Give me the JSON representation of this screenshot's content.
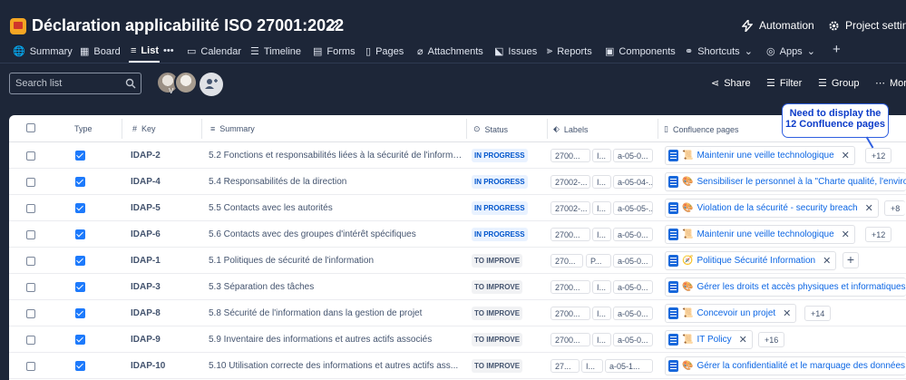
{
  "header": {
    "title": "Déclaration applicabilité ISO 27001:2022",
    "automation_label": "Automation",
    "settings_label": "Project setting"
  },
  "tabs": [
    {
      "label": "Summary"
    },
    {
      "label": "Board"
    },
    {
      "label": "List"
    },
    {
      "label": "•••"
    },
    {
      "label": "Calendar"
    },
    {
      "label": "Timeline"
    },
    {
      "label": "Forms"
    },
    {
      "label": "Pages"
    },
    {
      "label": "Attachments"
    },
    {
      "label": "Issues"
    },
    {
      "label": "Reports"
    },
    {
      "label": "Components"
    },
    {
      "label": "Shortcuts"
    },
    {
      "label": "Apps"
    },
    {
      "label": "+"
    }
  ],
  "toolbar": {
    "search_placeholder": "Search list",
    "avatar_badge": "V",
    "share_label": "Share",
    "filter_label": "Filter",
    "group_label": "Group",
    "more_label": "Mor"
  },
  "columns": {
    "type": "Type",
    "key": "Key",
    "summary": "Summary",
    "status": "Status",
    "labels": "Labels",
    "confluence": "Confluence pages"
  },
  "callout": "Need to display the 12 Confluence pages",
  "rows": [
    {
      "key": "IDAP-2",
      "summary": "5.2 Fonctions et responsabilités liées à la sécurité de l'informa...",
      "status": "IN PROGRESS",
      "status_type": "progress",
      "label1": "2700...",
      "label2": "I...",
      "label3": "a-05-0...",
      "page_emoji": "📜",
      "page": "Maintenir une veille technologique",
      "more": "+12"
    },
    {
      "key": "IDAP-4",
      "summary": "5.4 Responsabilités de la direction",
      "status": "IN PROGRESS",
      "status_type": "progress",
      "label1": "27002-...",
      "label2": "I...",
      "label3": "a-05-04-...",
      "page_emoji": "🎨",
      "page": "Sensibiliser le personnel à la \"Charte qualité, l'enviro",
      "more": ""
    },
    {
      "key": "IDAP-5",
      "summary": "5.5 Contacts avec les autorités",
      "status": "IN PROGRESS",
      "status_type": "progress",
      "label1": "27002-...",
      "label2": "I...",
      "label3": "a-05-05-...",
      "page_emoji": "🎨",
      "page": "Violation de la sécurité - security breach",
      "more": "+8"
    },
    {
      "key": "IDAP-6",
      "summary": "5.6 Contacts avec des groupes d'intérêt spécifiques",
      "status": "IN PROGRESS",
      "status_type": "progress",
      "label1": "2700...",
      "label2": "I...",
      "label3": "a-05-0...",
      "page_emoji": "📜",
      "page": "Maintenir une veille technologique",
      "more": "+12"
    },
    {
      "key": "IDAP-1",
      "summary": "5.1 Politiques de sécurité de l'information",
      "status": "TO IMPROVE",
      "status_type": "improve",
      "label1": "270...",
      "label2": "P...",
      "label3": "a-05-0...",
      "page_emoji": "🧭",
      "page": "Politique Sécurité Information",
      "more": "+"
    },
    {
      "key": "IDAP-3",
      "summary": "5.3 Séparation des tâches",
      "status": "TO IMPROVE",
      "status_type": "improve",
      "label1": "2700...",
      "label2": "I...",
      "label3": "a-05-0...",
      "page_emoji": "🎨",
      "page": "Gérer les droits et accès physiques et informatiques",
      "more": ""
    },
    {
      "key": "IDAP-8",
      "summary": "5.8 Sécurité de l'information dans la gestion de projet",
      "status": "TO IMPROVE",
      "status_type": "improve",
      "label1": "2700...",
      "label2": "I...",
      "label3": "a-05-0...",
      "page_emoji": "📜",
      "page": "Concevoir un projet",
      "more": "+14"
    },
    {
      "key": "IDAP-9",
      "summary": "5.9 Inventaire des informations et autres actifs associés",
      "status": "TO IMPROVE",
      "status_type": "improve",
      "label1": "2700...",
      "label2": "I...",
      "label3": "a-05-0...",
      "page_emoji": "📜",
      "page": "IT Policy",
      "more": "+16"
    },
    {
      "key": "IDAP-10",
      "summary": "5.10 Utilisation correcte des informations et autres actifs ass...",
      "status": "TO IMPROVE",
      "status_type": "improve",
      "label1": "27...",
      "label2": "I...",
      "label3": "a-05-1...",
      "page_emoji": "🎨",
      "page": "Gérer la confidentialité et le marquage des données",
      "more": ""
    }
  ]
}
